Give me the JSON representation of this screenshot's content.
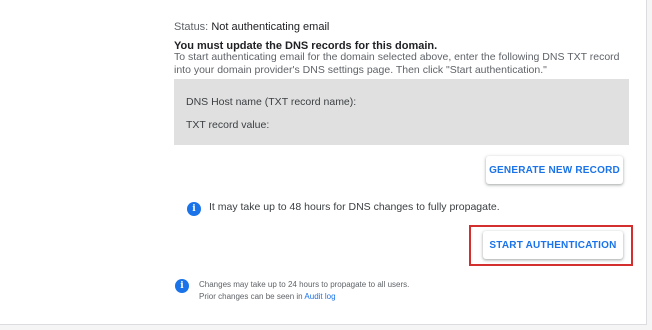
{
  "status": {
    "label": "Status:",
    "value": "Not authenticating email"
  },
  "dns_update": {
    "heading": "You must update the DNS records for this domain.",
    "instruction": "To start authenticating email for the domain selected above, enter the following DNS TXT record into your domain provider's DNS settings page. Then click \"Start authentication.\""
  },
  "dns_record": {
    "host_label": "DNS Host name (TXT record name):",
    "value_label": "TXT record value:"
  },
  "buttons": {
    "generate_label": "GENERATE NEW RECORD",
    "start_label": "START AUTHENTICATION"
  },
  "notes": {
    "propagate": "It may take up to 48 hours for DNS changes to fully propagate.",
    "changes_line1": "Changes may take up to 24 hours to propagate to all users.",
    "changes_line2_prefix": "Prior changes can be seen in",
    "audit_log_link": "Audit log"
  },
  "icons": {
    "info": "info-icon"
  },
  "colors": {
    "accent": "#1a73e8",
    "highlight": "#d32f2f",
    "dns_box_bg": "#e0e0e0"
  }
}
